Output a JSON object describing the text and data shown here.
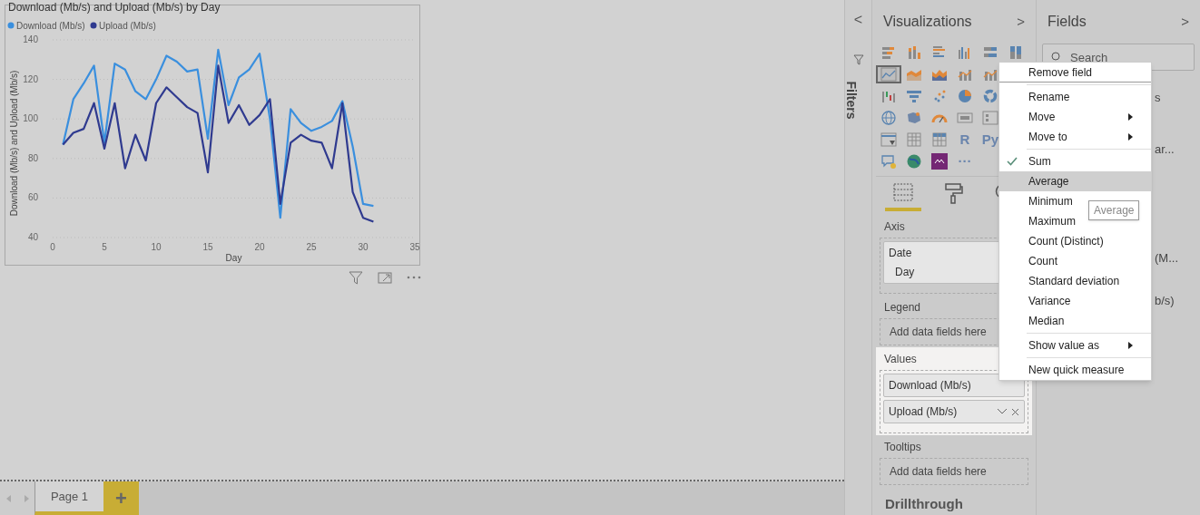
{
  "chart": {
    "chart_data": {
      "type": "line",
      "title": "Download (Mb/s) and Upload (Mb/s) by Day",
      "xlabel": "Day",
      "ylabel": "Download (Mb/s) and Upload (Mb/s)",
      "x": [
        1,
        2,
        3,
        4,
        5,
        6,
        7,
        8,
        9,
        10,
        11,
        12,
        13,
        14,
        15,
        16,
        17,
        18,
        19,
        20,
        21,
        22,
        23,
        24,
        25,
        26,
        27,
        28,
        29,
        30,
        31
      ],
      "xlim": [
        0,
        35
      ],
      "ylim": [
        40,
        140
      ],
      "xticks": [
        0,
        5,
        10,
        15,
        20,
        25,
        30,
        35
      ],
      "yticks": [
        40,
        60,
        80,
        100,
        120,
        140
      ],
      "grid": true,
      "legend": "top-left",
      "series": [
        {
          "name": "Download (Mb/s)",
          "color": "#3a8fde",
          "values": [
            87,
            110,
            118,
            127,
            88,
            128,
            125,
            114,
            110,
            120,
            132,
            129,
            124,
            125,
            90,
            135,
            107,
            121,
            125,
            133,
            100,
            50,
            105,
            98,
            94,
            96,
            99,
            109,
            86,
            57,
            56
          ]
        },
        {
          "name": "Upload (Mb/s)",
          "color": "#2f3a8f",
          "values": [
            87,
            93,
            95,
            108,
            85,
            108,
            75,
            92,
            79,
            108,
            116,
            111,
            106,
            103,
            73,
            127,
            98,
            107,
            97,
            102,
            110,
            57,
            88,
            92,
            89,
            88,
            75,
            108,
            63,
            50,
            48
          ]
        }
      ]
    }
  },
  "filters": {
    "label": "Filters",
    "collapse": "<"
  },
  "visualizations": {
    "title": "Visualizations",
    "expand": ">",
    "icon_rows": [
      [
        {
          "kind": "stacked-bar",
          "selected": false
        },
        {
          "kind": "stacked-column",
          "selected": false
        },
        {
          "kind": "clustered-bar",
          "selected": false
        },
        {
          "kind": "clustered-column",
          "selected": false
        },
        {
          "kind": "full-bar",
          "selected": false
        },
        {
          "kind": "full-column",
          "selected": false
        }
      ],
      [
        {
          "kind": "line",
          "selected": true
        },
        {
          "kind": "area",
          "selected": false
        },
        {
          "kind": "stacked-area",
          "selected": false
        },
        {
          "kind": "combo",
          "selected": false
        },
        {
          "kind": "combo",
          "selected": false
        }
      ],
      [
        {
          "kind": "waterfall",
          "selected": false
        },
        {
          "kind": "funnel",
          "selected": false
        },
        {
          "kind": "scatter",
          "selected": false
        },
        {
          "kind": "pie",
          "selected": false
        },
        {
          "kind": "donut",
          "selected": false
        }
      ],
      [
        {
          "kind": "globe",
          "selected": false
        },
        {
          "kind": "map",
          "selected": false
        },
        {
          "kind": "gauge",
          "selected": false
        },
        {
          "kind": "card",
          "selected": false
        },
        {
          "kind": "multirow",
          "selected": false
        }
      ],
      [
        {
          "kind": "slicer",
          "selected": false
        },
        {
          "kind": "table",
          "selected": false
        },
        {
          "kind": "matrix",
          "selected": false
        },
        {
          "kind": "text",
          "label": "R",
          "selected": false
        },
        {
          "kind": "text",
          "label": "Py",
          "selected": false
        }
      ],
      [
        {
          "kind": "qa",
          "selected": false
        },
        {
          "kind": "arcgis",
          "selected": false
        },
        {
          "kind": "powerapps",
          "selected": false
        },
        {
          "kind": "text",
          "label": "···",
          "selected": false
        }
      ]
    ],
    "tabs": [
      {
        "kind": "fields",
        "selected": true
      },
      {
        "kind": "format",
        "selected": false
      },
      {
        "kind": "analytics",
        "selected": false
      }
    ],
    "wells": [
      {
        "title": "Axis",
        "highlighted": false,
        "fields": [
          {
            "label": "Date",
            "sub": "Day"
          }
        ]
      },
      {
        "title": "Legend",
        "highlighted": false,
        "placeholder": "Add data fields here"
      },
      {
        "title": "Values",
        "highlighted": true,
        "fields": [
          {
            "label": "Download (Mb/s)"
          },
          {
            "label": "Upload (Mb/s)",
            "controls": true
          }
        ]
      },
      {
        "title": "Tooltips",
        "highlighted": false,
        "placeholder": "Add data fields here"
      }
    ],
    "drillthrough": "Drillthrough"
  },
  "fields": {
    "title": "Fields",
    "expand": ">",
    "search": {
      "placeholder": "Search"
    },
    "items": [
      "s",
      "ar...",
      "(M...",
      "b/s)"
    ]
  },
  "menu": {
    "items": [
      {
        "kind": "item",
        "label": "Remove field",
        "checked": false,
        "submenu": false,
        "selected": false
      },
      {
        "kind": "separator"
      },
      {
        "kind": "item",
        "label": "Rename",
        "checked": false,
        "submenu": false,
        "selected": false
      },
      {
        "kind": "item",
        "label": "Move",
        "checked": false,
        "submenu": true,
        "selected": false
      },
      {
        "kind": "item",
        "label": "Move to",
        "checked": false,
        "submenu": true,
        "selected": false
      },
      {
        "kind": "separator"
      },
      {
        "kind": "item",
        "label": "Sum",
        "checked": true,
        "submenu": false,
        "selected": false
      },
      {
        "kind": "item",
        "label": "Average",
        "checked": false,
        "submenu": false,
        "selected": true
      },
      {
        "kind": "item",
        "label": "Minimum",
        "checked": false,
        "submenu": false,
        "selected": false
      },
      {
        "kind": "item",
        "label": "Maximum",
        "checked": false,
        "submenu": false,
        "selected": false
      },
      {
        "kind": "item",
        "label": "Count (Distinct)",
        "checked": false,
        "submenu": false,
        "selected": false
      },
      {
        "kind": "item",
        "label": "Count",
        "checked": false,
        "submenu": false,
        "selected": false
      },
      {
        "kind": "item",
        "label": "Standard deviation",
        "checked": false,
        "submenu": false,
        "selected": false
      },
      {
        "kind": "item",
        "label": "Variance",
        "checked": false,
        "submenu": false,
        "selected": false
      },
      {
        "kind": "item",
        "label": "Median",
        "checked": false,
        "submenu": false,
        "selected": false
      },
      {
        "kind": "separator"
      },
      {
        "kind": "item",
        "label": "Show value as",
        "checked": false,
        "submenu": true,
        "selected": false
      },
      {
        "kind": "separator"
      },
      {
        "kind": "item",
        "label": "New quick measure",
        "checked": false,
        "submenu": false,
        "selected": false
      }
    ]
  },
  "tooltip": "Average",
  "pages": {
    "tabs": [
      {
        "label": "Page 1",
        "selected": true
      }
    ],
    "add": "+"
  }
}
